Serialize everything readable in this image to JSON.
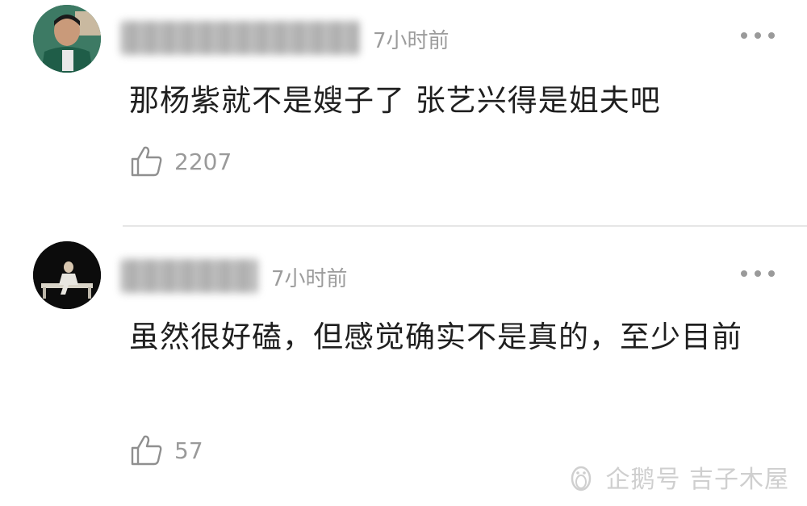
{
  "comments": [
    {
      "time": "7小时前",
      "text": "那杨紫就不是嫂子了 张艺兴得是姐夫吧",
      "likes": "2207",
      "avatar_icon": "avatar-person-green-jacket",
      "like_icon": "thumbs-up-icon",
      "more_icon": "more-dots-icon"
    },
    {
      "time": "7小时前",
      "text": "虽然很好磕，但感觉确实不是真的，至少目前",
      "likes": "57",
      "avatar_icon": "avatar-person-dark",
      "like_icon": "thumbs-up-icon",
      "more_icon": "more-dots-icon"
    }
  ],
  "watermark": {
    "text": "企鹅号 吉子木屋",
    "icon": "penguin-logo-icon"
  },
  "colors": {
    "background": "#ffffff",
    "text": "#1f1f1f",
    "muted": "#9c9c9c",
    "divider": "#e6e6e6"
  }
}
